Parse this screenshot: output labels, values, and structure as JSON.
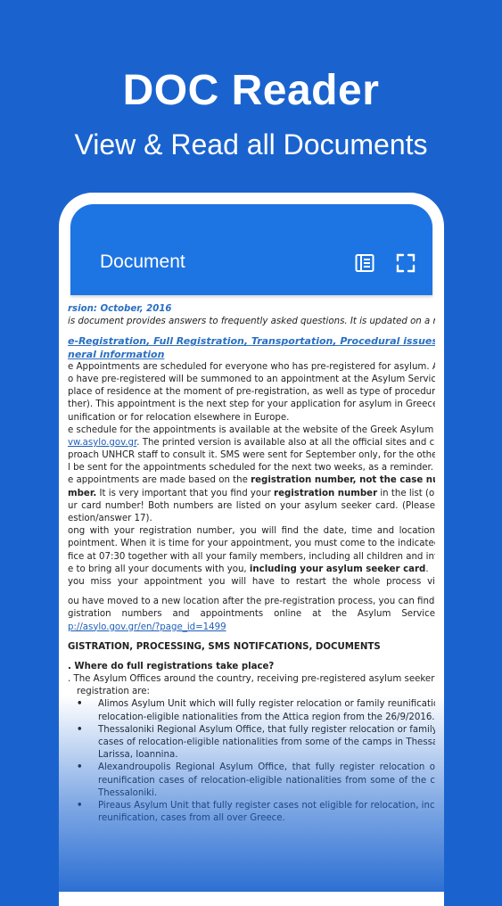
{
  "hero": {
    "title": "DOC Reader",
    "subtitle": "View & Read all Documents"
  },
  "app_bar": {
    "title": "Document",
    "icons": [
      "list-view-icon",
      "fullscreen-icon"
    ]
  },
  "colors": {
    "background": "#1a63cf",
    "app_bar": "#1d74e3",
    "link": "#1f5fb8"
  },
  "document": {
    "version": "rsion: October, 2016",
    "intro": "is document provides answers to frequently asked questions. It is updated on a regula",
    "heading_1": "e-Registration, Full Registration, Transportation, Procedural issues",
    "heading_2": "neral information",
    "p1": [
      "e Appointments are scheduled for everyone who has pre-registered for asylum. All",
      "o have pre-registered will be summoned to an appointment at the Asylum Service, de",
      "place of residence at the moment of pre-registration, as well as type of procedure (e",
      "ther). This appointment is the next step for your application for asylum in Greece, fo",
      "unification or for relocation elsewhere in Europe."
    ],
    "p2_a": "e schedule for the appointments is available at the website of the Greek Asylum S",
    "p2_link": "vw.asylo.gov.gr",
    "p2_b": ". The printed version is available also at all the official sites and camp",
    "p2_rest": [
      "proach UNHCR staff to consult it. SMS were sent for September only, for the other mo",
      "l be sent for the appointments scheduled for the next two weeks, as a reminder."
    ],
    "p3_a": "e appointments are made based on the ",
    "p3_bold": "registration number, not the case number",
    "p3_line2_bold": "mber.",
    "p3_line2_a": " It is very important that you find your ",
    "p3_line2_bold2": "registration number",
    "p3_line2_b": " in the list (or SMS)",
    "p3_rest": [
      "ur card number! Both numbers are listed on your asylum seeker card. (Please",
      "estion/answer 17)."
    ],
    "p4": [
      "ong with your registration number, you will find the date, time and location",
      "pointment. When it is time for your appointment, you must come to the indicatec",
      "fice at 07:30 together with all your family members, including all children and infan"
    ],
    "p4_last_a": "e to bring all your documents with you, ",
    "p4_last_bold": "including your asylum seeker card",
    "p4_last_b": ".",
    "p5": "you miss your appointment you will have to restart the whole process vi",
    "p6": [
      "ou have moved to a new location after the pre-registration process, you can find a",
      "gistration numbers and appointments online at the Asylum Service"
    ],
    "p6_link": "p://asylo.gov.gr/en/?page_id=1499",
    "section_2": "GISTRATION, PROCESSING, SMS NOTIFCATIONS, DOCUMENTS",
    "question": ". Where do full registrations take place?",
    "answer": [
      ". The Asylum Offices around the country, receiving pre-registered asylum seekers for",
      "registration are:"
    ],
    "bullets": [
      [
        "Alimos Asylum Unit which will fully register relocation or family reunification",
        "relocation-eligible nationalities from the Attica region from the 26/9/2016."
      ],
      [
        "Thessaloniki Regional Asylum Office, that fully register relocation or family reur",
        "cases of relocation-eligible nationalities from some of the camps in Thessalor",
        "Larissa, Ioannina."
      ],
      [
        "Alexandroupolis Regional Asylum Office, that fully register relocation o",
        "reunification cases of relocation-eligible nationalities from some of the c",
        "Thessaloniki."
      ],
      [
        "Pireaus Asylum Unit that fully register cases not eligible for relocation, includir",
        "reunification, cases from all over Greece."
      ]
    ]
  }
}
